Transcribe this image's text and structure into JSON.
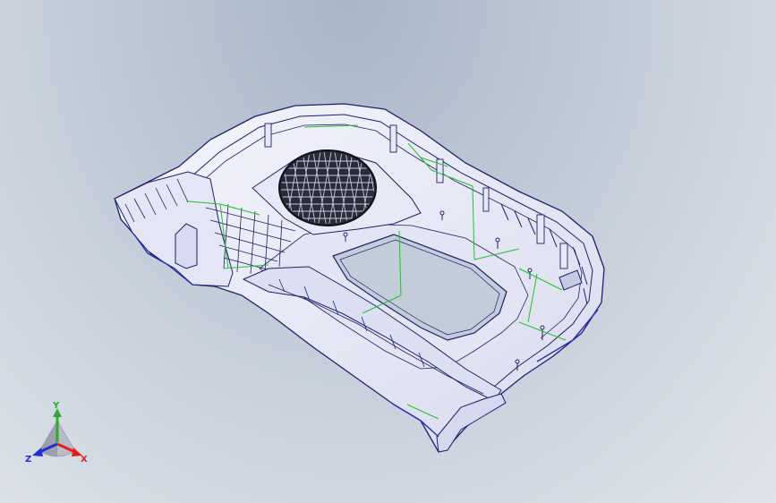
{
  "viewport": {
    "background_top": "#a8b6c7",
    "background_bottom": "#e0e4ea"
  },
  "model": {
    "edge_color": "#1e1e6e",
    "surface_color": "#eef0fa",
    "shadow_color": "#cfd2ea",
    "sketch_color": "#22c22a",
    "grille_color": "#101018"
  },
  "triad": {
    "y_label": "Y",
    "x_label": "X",
    "z_label": "Z",
    "y_color": "#2faa2f",
    "x_color": "#e02020",
    "z_color": "#2030d0"
  }
}
